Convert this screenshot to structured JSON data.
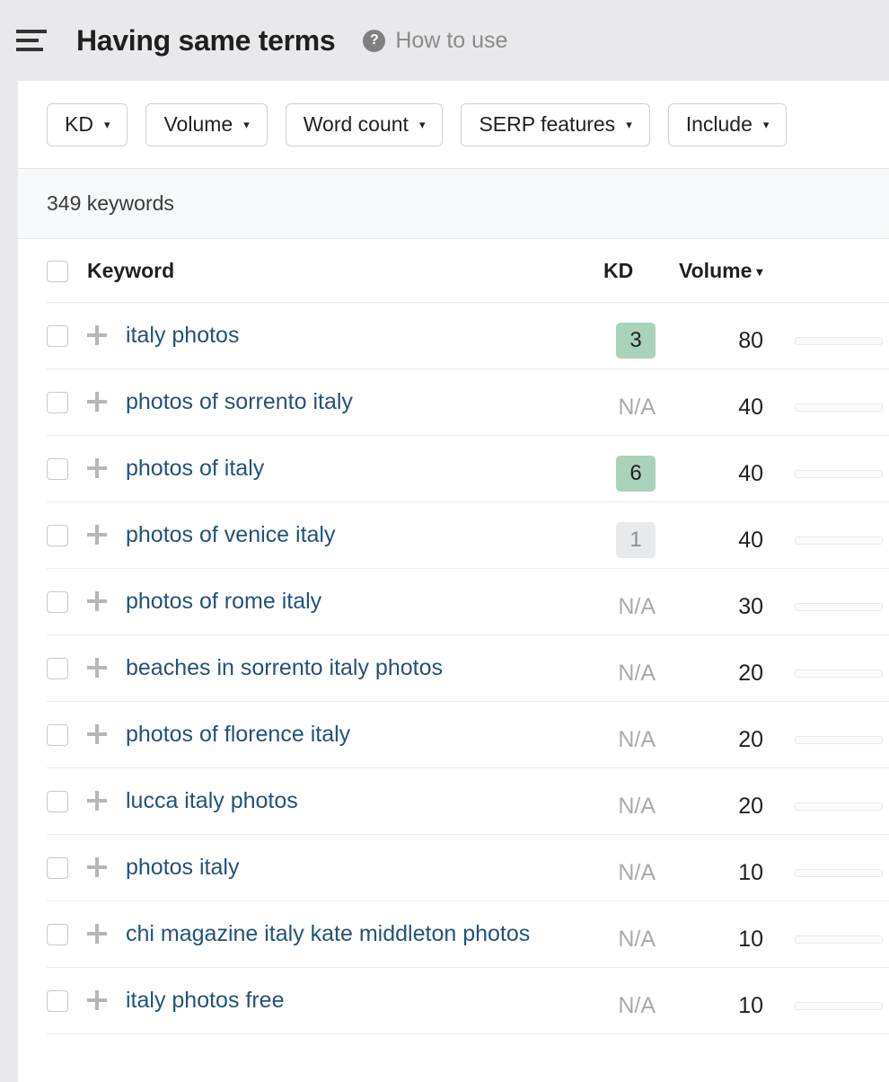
{
  "header": {
    "menu_icon": "hamburger-icon",
    "title": "Having same terms",
    "help_icon": "question-mark-icon",
    "help_label": "How to use"
  },
  "filters": [
    {
      "label": "KD",
      "caret": "▾"
    },
    {
      "label": "Volume",
      "caret": "▾"
    },
    {
      "label": "Word count",
      "caret": "▾"
    },
    {
      "label": "SERP features",
      "caret": "▾"
    },
    {
      "label": "Include",
      "caret": "▾"
    }
  ],
  "summary": {
    "count_text": "349 keywords"
  },
  "table": {
    "columns": {
      "keyword": "Keyword",
      "kd": "KD",
      "volume": "Volume",
      "sort_caret": "▾"
    },
    "rows": [
      {
        "keyword": "italy photos",
        "kd": "3",
        "kd_style": "green",
        "volume": "80"
      },
      {
        "keyword": "photos of sorrento italy",
        "kd": "N/A",
        "kd_style": "na",
        "volume": "40"
      },
      {
        "keyword": "photos of italy",
        "kd": "6",
        "kd_style": "green",
        "volume": "40"
      },
      {
        "keyword": "photos of venice italy",
        "kd": "1",
        "kd_style": "gray",
        "volume": "40"
      },
      {
        "keyword": "photos of rome italy",
        "kd": "N/A",
        "kd_style": "na",
        "volume": "30"
      },
      {
        "keyword": "beaches in sorrento italy photos",
        "kd": "N/A",
        "kd_style": "na",
        "volume": "20"
      },
      {
        "keyword": "photos of florence italy",
        "kd": "N/A",
        "kd_style": "na",
        "volume": "20"
      },
      {
        "keyword": "lucca italy photos",
        "kd": "N/A",
        "kd_style": "na",
        "volume": "20"
      },
      {
        "keyword": "photos italy",
        "kd": "N/A",
        "kd_style": "na",
        "volume": "10"
      },
      {
        "keyword": "chi magazine italy kate middleton photos",
        "kd": "N/A",
        "kd_style": "na",
        "volume": "10"
      },
      {
        "keyword": "italy photos free",
        "kd": "N/A",
        "kd_style": "na",
        "volume": "10"
      }
    ]
  },
  "colors": {
    "page_background": "#e9e9eb",
    "card_background": "#ffffff",
    "summary_background": "#f7f8f9",
    "link": "#23527c",
    "kd_green": "#a9d2bb",
    "kd_gray": "#e8e9ea",
    "muted_text": "#a8abae"
  }
}
